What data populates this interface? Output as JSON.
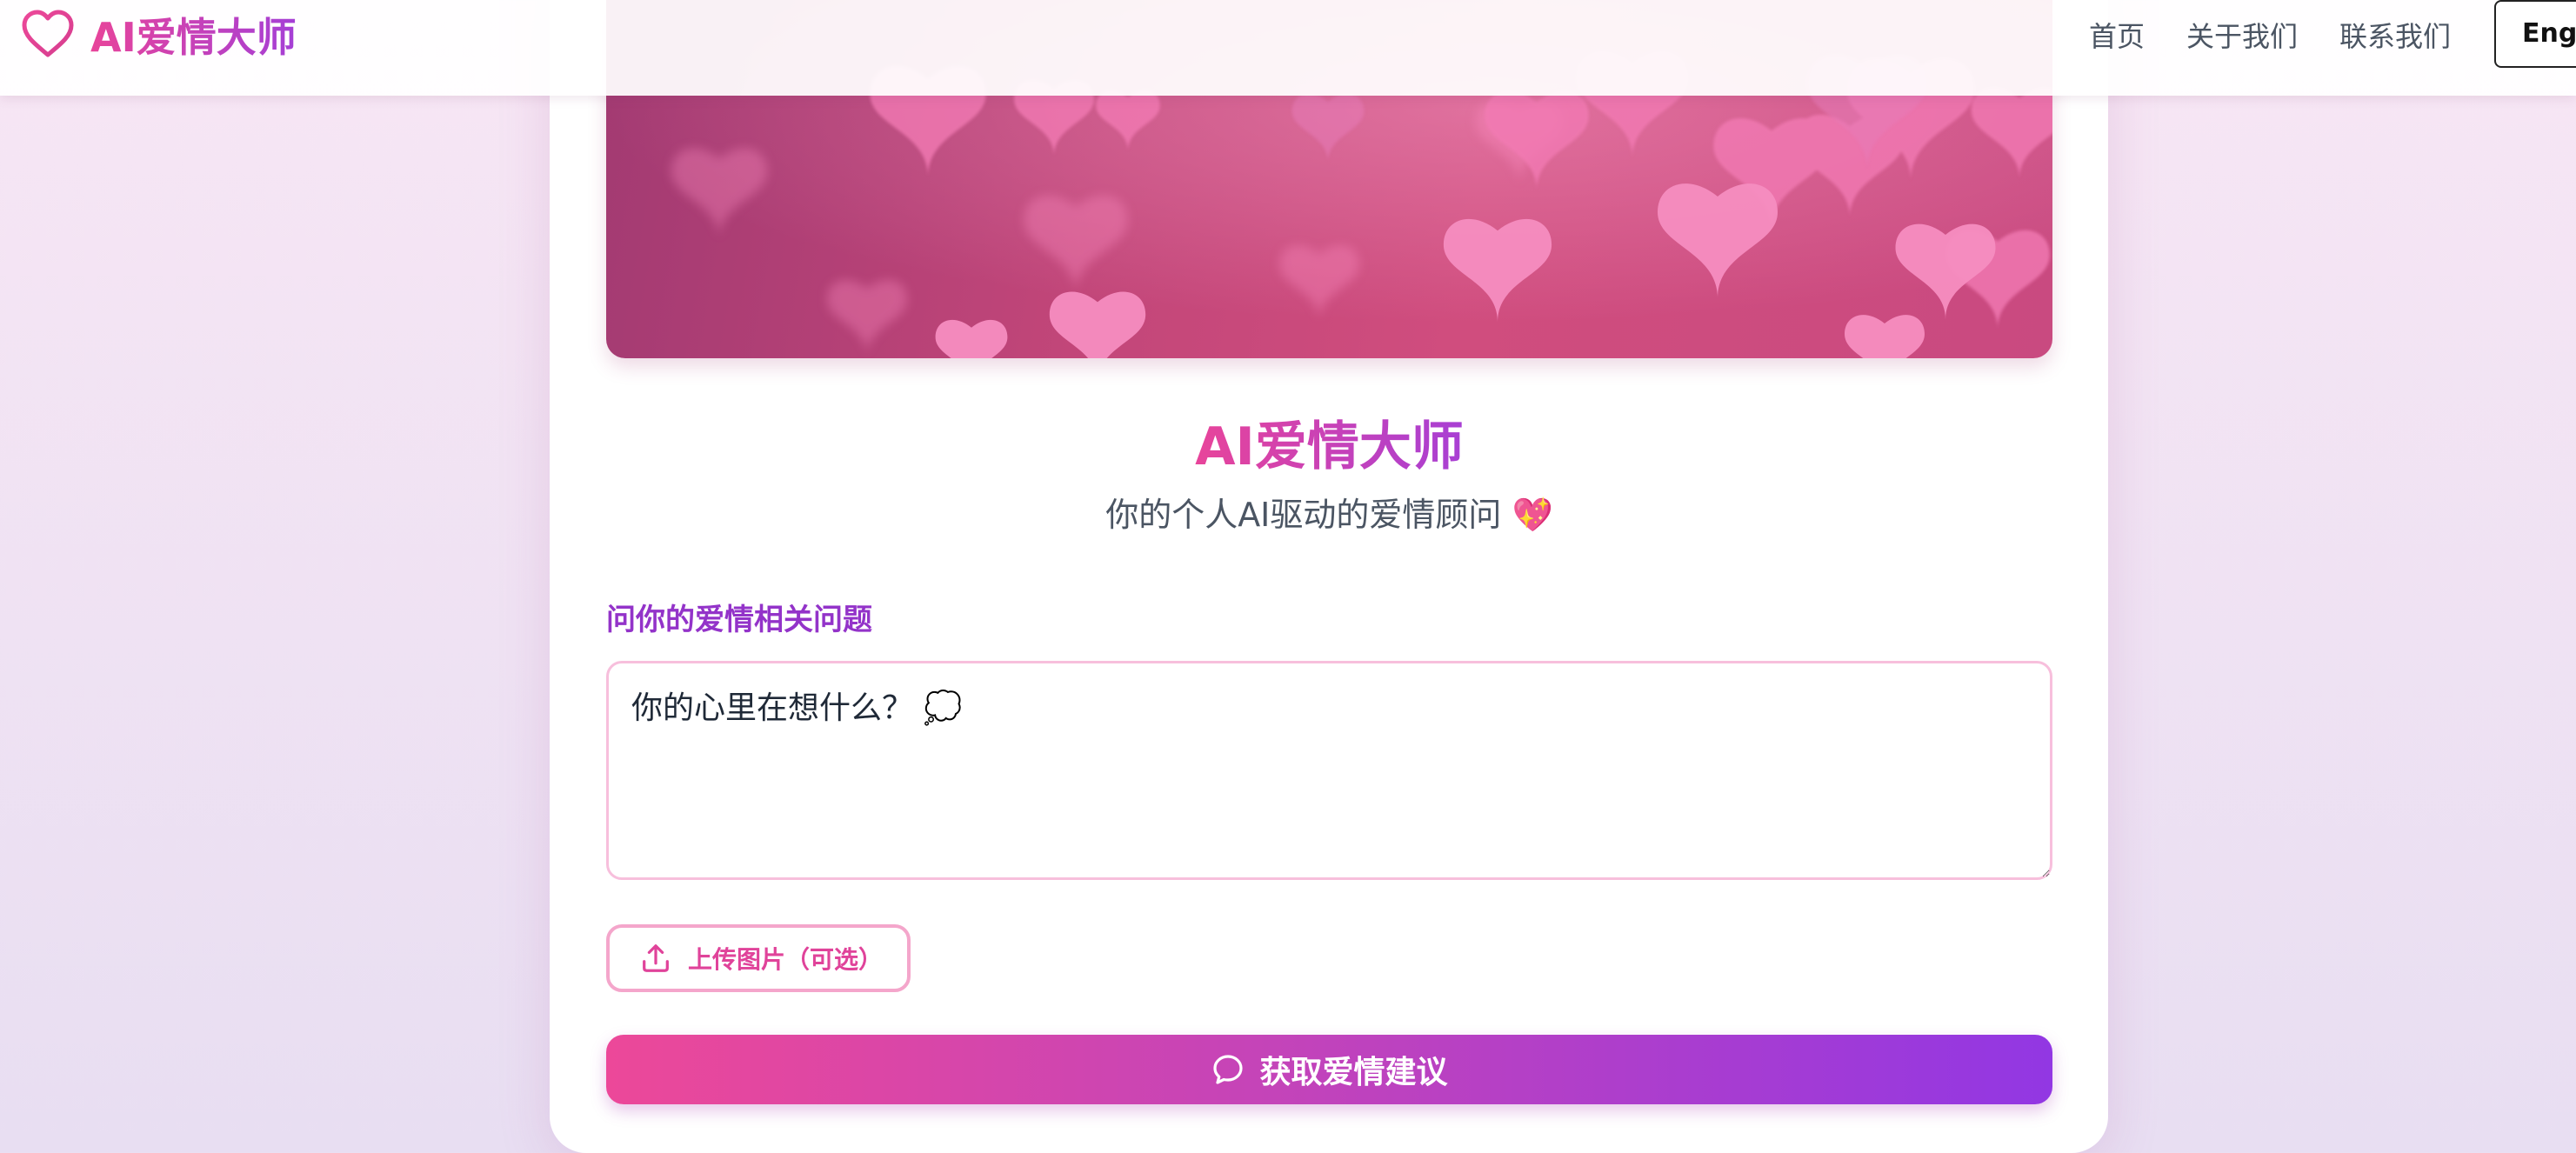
{
  "navbar": {
    "brand": {
      "icon": "heart-outline-icon",
      "name": "AI爱情大师"
    },
    "links": [
      "首页",
      "关于我们",
      "联系我们"
    ],
    "language_button": "Engli"
  },
  "hero": {
    "image": "pink-hearts-bokeh-banner"
  },
  "main": {
    "title": "AI爱情大师",
    "subtitle": "你的个人AI驱动的爱情顾问 💖",
    "question_label": "问你的爱情相关问题",
    "question_placeholder": "你的心里在想什么？ 💭",
    "question_value": "",
    "upload_button": {
      "icon": "upload-icon",
      "label": "上传图片（可选）"
    },
    "submit_button": {
      "icon": "chat-bubble-icon",
      "label": "获取爱情建议"
    }
  },
  "colors": {
    "brand_pink": "#ec4899",
    "brand_purple": "#9333ea",
    "label_purple": "#9333c9",
    "input_border": "#f7bfdc",
    "text_gray": "#4b5563"
  }
}
